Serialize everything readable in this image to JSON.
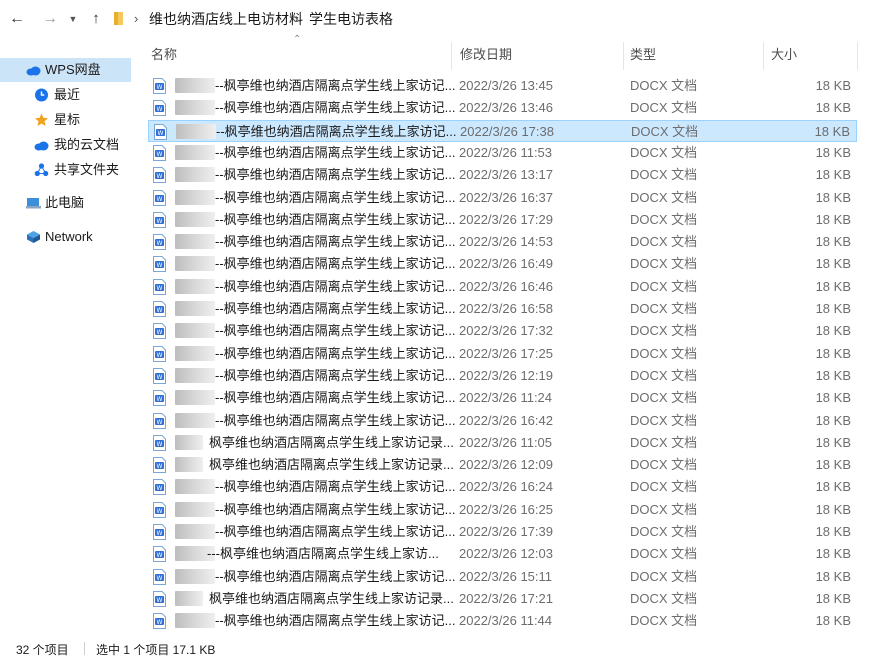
{
  "address": {
    "crumbs": [
      "维也纳酒店线上电访材料",
      "学生电访表格"
    ]
  },
  "sidebar": {
    "items": [
      {
        "label": "WPS网盘",
        "icon": "cloud-icon",
        "selected": true
      },
      {
        "label": "最近",
        "icon": "clock-icon"
      },
      {
        "label": "星标",
        "icon": "star-icon"
      },
      {
        "label": "我的云文档",
        "icon": "cloud-icon"
      },
      {
        "label": "共享文件夹",
        "icon": "share-icon"
      },
      {
        "label": "此电脑",
        "icon": "computer-icon"
      },
      {
        "label": "Network",
        "icon": "network-icon"
      }
    ]
  },
  "columns": {
    "name": "名称",
    "date": "修改日期",
    "type": "类型",
    "size": "大小"
  },
  "files": [
    {
      "name": "--枫亭维也纳酒店隔离点学生线上家访记...",
      "date": "2022/3/26 13:45",
      "type": "DOCX 文档",
      "size": "18 KB"
    },
    {
      "name": "--枫亭维也纳酒店隔离点学生线上家访记...",
      "date": "2022/3/26 13:46",
      "type": "DOCX 文档",
      "size": "18 KB"
    },
    {
      "name": "--枫亭维也纳酒店隔离点学生线上家访记...",
      "date": "2022/3/26 17:38",
      "type": "DOCX 文档",
      "size": "18 KB",
      "selected": true
    },
    {
      "name": "--枫亭维也纳酒店隔离点学生线上家访记...",
      "date": "2022/3/26 11:53",
      "type": "DOCX 文档",
      "size": "18 KB"
    },
    {
      "name": "--枫亭维也纳酒店隔离点学生线上家访记...",
      "date": "2022/3/26 13:17",
      "type": "DOCX 文档",
      "size": "18 KB"
    },
    {
      "name": "--枫亭维也纳酒店隔离点学生线上家访记...",
      "date": "2022/3/26 16:37",
      "type": "DOCX 文档",
      "size": "18 KB"
    },
    {
      "name": "--枫亭维也纳酒店隔离点学生线上家访记...",
      "date": "2022/3/26 17:29",
      "type": "DOCX 文档",
      "size": "18 KB"
    },
    {
      "name": "--枫亭维也纳酒店隔离点学生线上家访记...",
      "date": "2022/3/26 14:53",
      "type": "DOCX 文档",
      "size": "18 KB"
    },
    {
      "name": "--枫亭维也纳酒店隔离点学生线上家访记...",
      "date": "2022/3/26 16:49",
      "type": "DOCX 文档",
      "size": "18 KB"
    },
    {
      "name": "--枫亭维也纳酒店隔离点学生线上家访记...",
      "date": "2022/3/26 16:46",
      "type": "DOCX 文档",
      "size": "18 KB"
    },
    {
      "name": "--枫亭维也纳酒店隔离点学生线上家访记...",
      "date": "2022/3/26 16:58",
      "type": "DOCX 文档",
      "size": "18 KB"
    },
    {
      "name": "--枫亭维也纳酒店隔离点学生线上家访记...",
      "date": "2022/3/26 17:32",
      "type": "DOCX 文档",
      "size": "18 KB"
    },
    {
      "name": "--枫亭维也纳酒店隔离点学生线上家访记...",
      "date": "2022/3/26 17:25",
      "type": "DOCX 文档",
      "size": "18 KB"
    },
    {
      "name": "--枫亭维也纳酒店隔离点学生线上家访记...",
      "date": "2022/3/26 12:19",
      "type": "DOCX 文档",
      "size": "18 KB"
    },
    {
      "name": "--枫亭维也纳酒店隔离点学生线上家访记...",
      "date": "2022/3/26 11:24",
      "type": "DOCX 文档",
      "size": "18 KB"
    },
    {
      "name": "--枫亭维也纳酒店隔离点学生线上家访记...",
      "date": "2022/3/26 16:42",
      "type": "DOCX 文档",
      "size": "18 KB"
    },
    {
      "name": "枫亭维也纳酒店隔离点学生线上家访记录...",
      "date": "2022/3/26 11:05",
      "type": "DOCX 文档",
      "size": "18 KB",
      "short": true
    },
    {
      "name": "枫亭维也纳酒店隔离点学生线上家访记录...",
      "date": "2022/3/26 12:09",
      "type": "DOCX 文档",
      "size": "18 KB",
      "short": true
    },
    {
      "name": "--枫亭维也纳酒店隔离点学生线上家访记...",
      "date": "2022/3/26 16:24",
      "type": "DOCX 文档",
      "size": "18 KB"
    },
    {
      "name": "--枫亭维也纳酒店隔离点学生线上家访记...",
      "date": "2022/3/26 16:25",
      "type": "DOCX 文档",
      "size": "18 KB"
    },
    {
      "name": "--枫亭维也纳酒店隔离点学生线上家访记...",
      "date": "2022/3/26 17:39",
      "type": "DOCX 文档",
      "size": "18 KB"
    },
    {
      "name": "---枫亭维也纳酒店隔离点学生线上家访...",
      "date": "2022/3/26 12:03",
      "type": "DOCX 文档",
      "size": "18 KB"
    },
    {
      "name": "--枫亭维也纳酒店隔离点学生线上家访记...",
      "date": "2022/3/26 15:11",
      "type": "DOCX 文档",
      "size": "18 KB"
    },
    {
      "name": "枫亭维也纳酒店隔离点学生线上家访记录...",
      "date": "2022/3/26 17:21",
      "type": "DOCX 文档",
      "size": "18 KB",
      "short": true
    },
    {
      "name": "--枫亭维也纳酒店隔离点学生线上家访记...",
      "date": "2022/3/26 11:44",
      "type": "DOCX 文档",
      "size": "18 KB"
    }
  ],
  "status": {
    "count": "32 个项目",
    "selection": "选中 1 个项目  17.1 KB"
  },
  "colors": {
    "accent": "#0078d4",
    "selection_bg": "#cce8ff",
    "selection_border": "#99d1ff",
    "sidebar_selected": "#cce4f7",
    "folder": "#f7c85c"
  }
}
